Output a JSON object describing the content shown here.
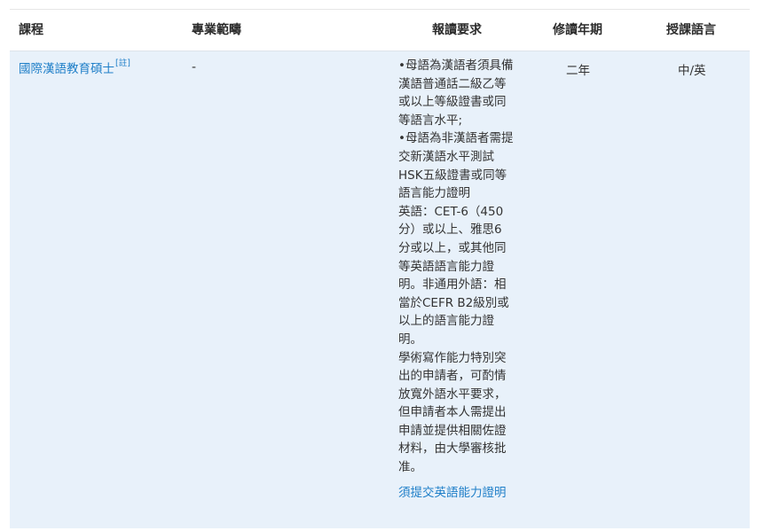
{
  "header": {
    "course": "課程",
    "field": "專業範疇",
    "requirements": "報讀要求",
    "duration": "修讀年期",
    "language": "授課語言"
  },
  "rows": [
    {
      "course": "國際漢語教育碩士",
      "course_note": "[註]",
      "field": "-",
      "requirements": [
        "•母語為漢語者須具備",
        "漢語普通話二級乙等",
        "或以上等級證書或同",
        "等語言水平;",
        "•母語為非漢語者需提",
        "交新漢語水平測試",
        "HSK五級證書或同等",
        "語言能力證明",
        "英語：CET-6（450",
        "分）或以上、雅思6",
        "分或以上，或其他同",
        "等英語語言能力證",
        "明。非通用外語：相",
        "當於CEFR B2級別或",
        "以上的語言能力證",
        "明。",
        "學術寫作能力特別突",
        "出的申請者，可酌情",
        "放寬外語水平要求，",
        "但申請者本人需提出",
        "申請並提供相關佐證",
        "材料，由大學審核批",
        "准。"
      ],
      "requirements_link": "須提交英語能力證明",
      "duration": "二年",
      "language": "中/英"
    }
  ]
}
